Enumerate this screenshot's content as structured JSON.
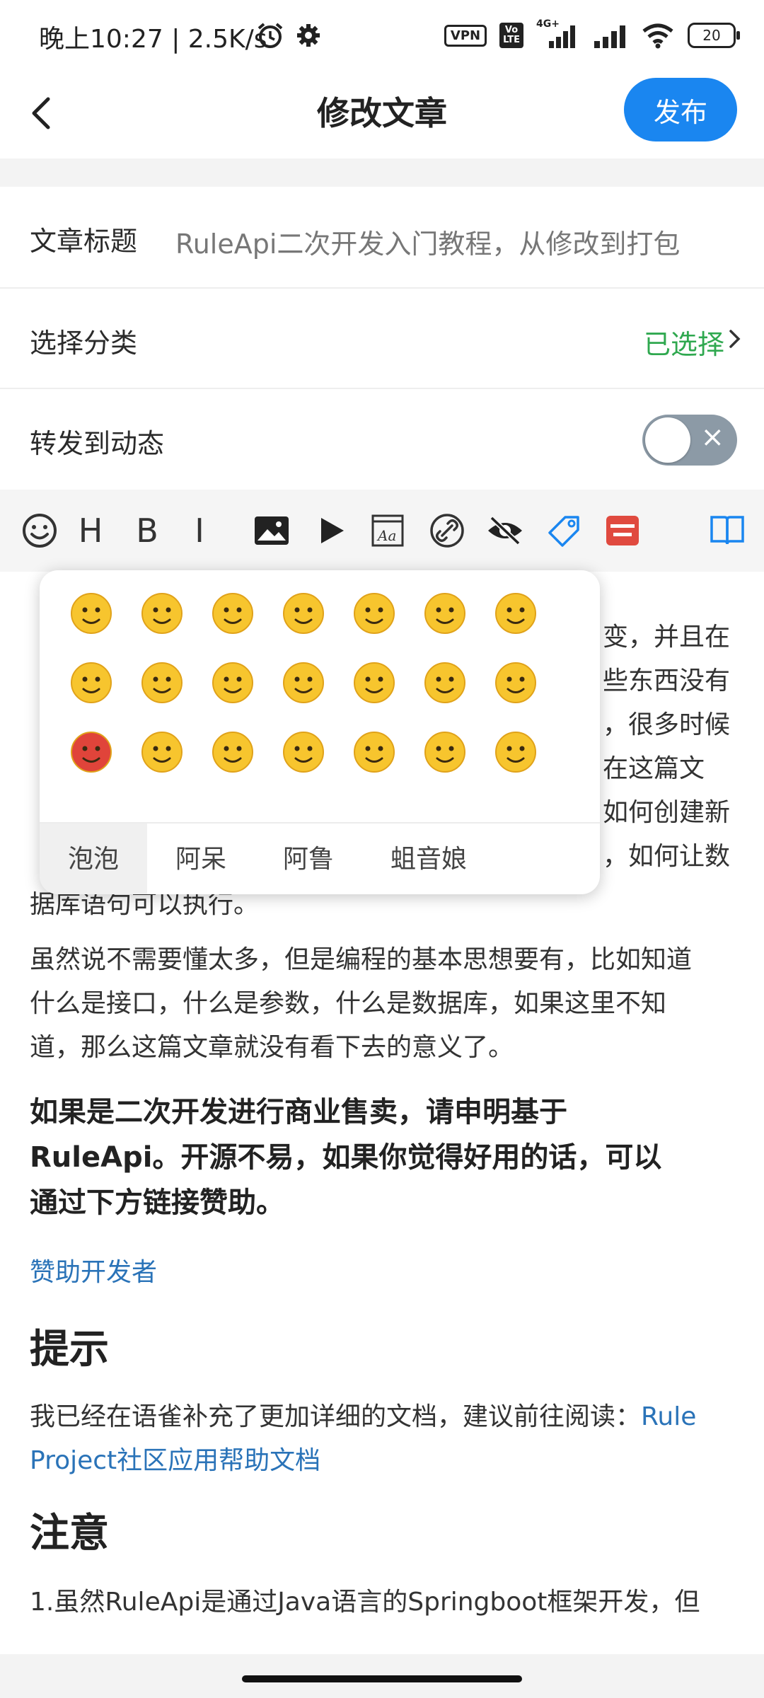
{
  "status_bar": {
    "time": "晚上10:27 | 2.5K/s",
    "vpn": "VPN",
    "volte": "Vo LTE",
    "net_type": "4G+",
    "battery": "20"
  },
  "header": {
    "title": "修改文章",
    "publish_label": "发布"
  },
  "form": {
    "title_label": "文章标题",
    "title_value": "RuleApi二次开发入门教程，从修改到打包",
    "category_label": "选择分类",
    "category_value": "已选择",
    "forward_label": "转发到动态",
    "forward_on": false
  },
  "toolbar": {
    "heading_label": "H",
    "bold_label": "B",
    "italic_label": "I",
    "icons": [
      "emoji-icon",
      "heading-icon",
      "bold-icon",
      "italic-icon",
      "image-icon",
      "video-icon",
      "font-icon",
      "link-icon",
      "hide-icon",
      "tag-icon",
      "shop-icon",
      "book-icon"
    ],
    "accent_blue": "#1a86f0",
    "accent_red": "#e04a3f"
  },
  "emoji_panel": {
    "tabs": [
      "泡泡",
      "阿呆",
      "阿鲁",
      "蛆音娘"
    ],
    "active_tab": "泡泡",
    "emoji_names": [
      "smile",
      "grin",
      "tongue",
      "scared",
      "cool",
      "angry",
      "shy",
      "sweat",
      "cry",
      "embarrassed",
      "sad",
      "thinking",
      "money",
      "frown",
      "red-face",
      "vomit",
      "confused",
      "pout",
      "laugh",
      "smug",
      "blush"
    ]
  },
  "content": {
    "hidden_para_1_right": [
      "变，并且在",
      "些东西没有",
      "，很多时候",
      "在这篇文",
      "如何创建新",
      "，如何让数"
    ],
    "hidden_para_1_tail": "据库语句可以执行。",
    "para_2": [
      "虽然说不需要懂太多，但是编程的基本思想要有，比如知道",
      "什么是接口，什么是参数，什么是数据库，如果这里不知",
      "道，那么这篇文章就没有看下去的意义了。"
    ],
    "bold_para": [
      "如果是二次开发进行商业售卖，请申明基于",
      "RuleApi。开源不易，如果你觉得好用的话，可以",
      "通过下方链接赞助。"
    ],
    "sponsor_link": "赞助开发者",
    "heading_tip": "提示",
    "tip_text": "我已经在语雀补充了更加详细的文档，建议前往阅读：",
    "tip_link_1": "Rule",
    "tip_link_2": "Project社区应用帮助文档",
    "heading_note": "注意",
    "note_line": "1.虽然RuleApi是通过Java语言的Springboot框架开发，但"
  }
}
